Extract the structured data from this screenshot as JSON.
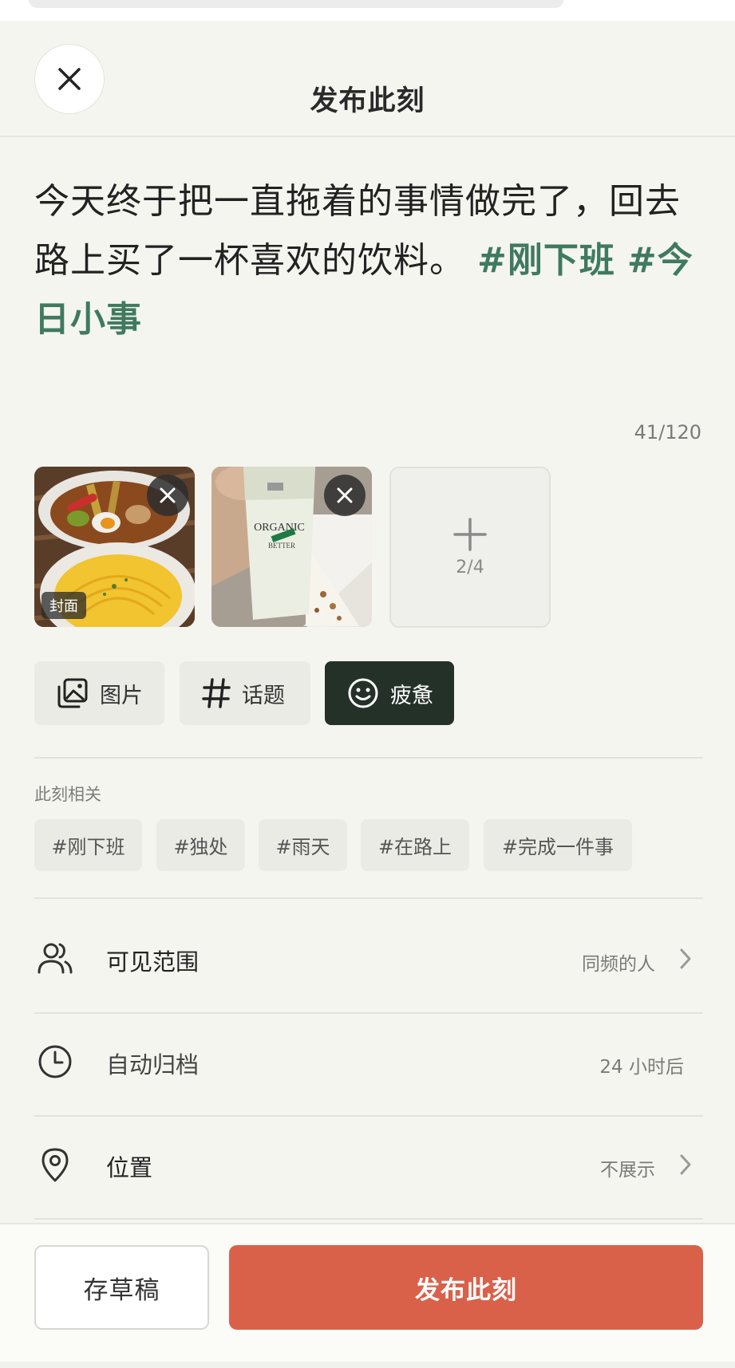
{
  "header": {
    "title": "发布此刻",
    "close_icon": "close-icon"
  },
  "post": {
    "body_text": "今天终于把一直拖着的事情做完了，回去路上买了一杯喜欢的饮料。",
    "tags": [
      "#刚下班",
      "#今日小事"
    ],
    "char_count": "41/120"
  },
  "photos": {
    "items": [
      {
        "description": "food bowls",
        "remove_icon": "close-icon"
      },
      {
        "description": "drink cup",
        "remove_icon": "close-icon"
      }
    ],
    "cover_label": "封面",
    "add_count": "2/4",
    "add_icon": "plus-icon"
  },
  "tools": {
    "image_label": "图片",
    "topic_label": "话题",
    "mood_label": "疲惫",
    "mood_active": true
  },
  "related": {
    "label": "此刻相关",
    "chips": [
      "#刚下班",
      "#独处",
      "#雨天",
      "#在路上",
      "#完成一件事"
    ]
  },
  "settings": {
    "visibility": {
      "label": "可见范围",
      "value": "同频的人",
      "icon": "users-icon"
    },
    "archive": {
      "label": "自动归档",
      "value": "24 小时后",
      "icon": "clock-icon"
    },
    "location": {
      "label": "位置",
      "value": "不展示",
      "icon": "location-pin-icon"
    }
  },
  "footer": {
    "draft_label": "存草稿",
    "publish_label": "发布此刻"
  },
  "colors": {
    "accent_green": "#3f7a5f",
    "publish_red": "#d9614a",
    "mood_dark": "#243129",
    "background": "#f5f5f0"
  }
}
